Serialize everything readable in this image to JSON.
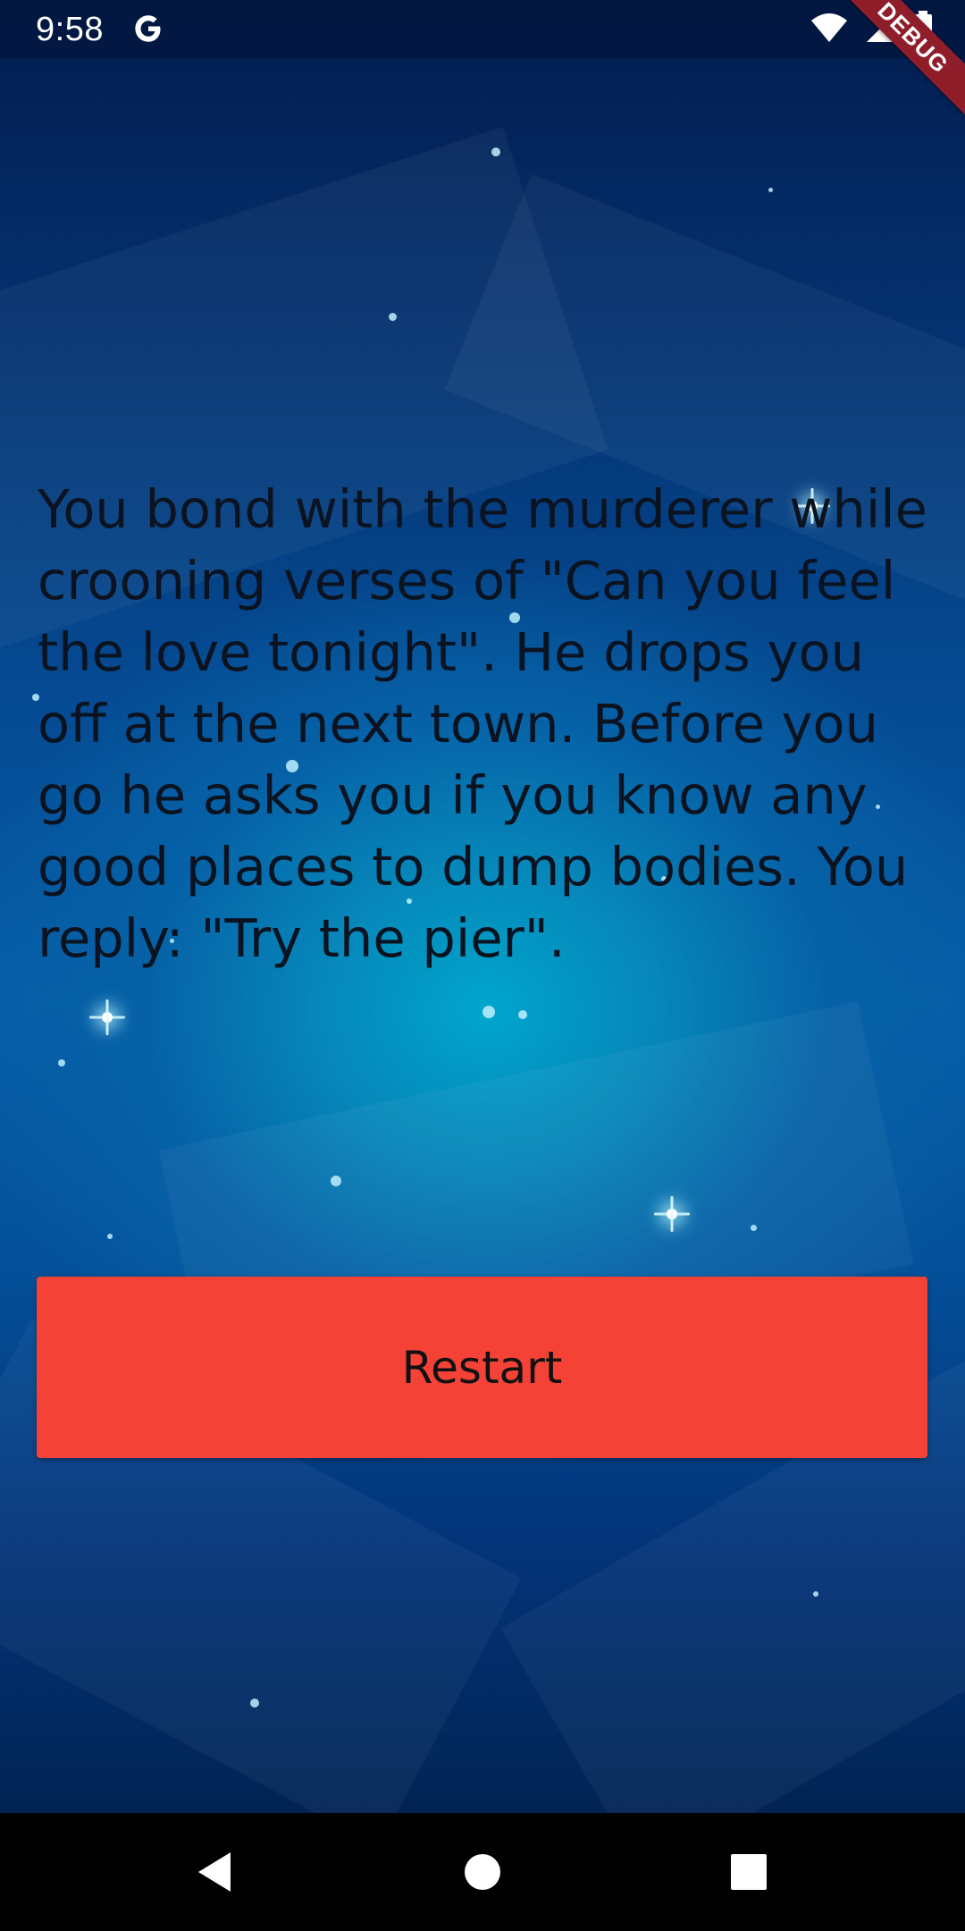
{
  "status_bar": {
    "time": "9:58",
    "notification_icons": [
      "google-g-icon"
    ],
    "system_icons": [
      "wifi-icon",
      "signal-icon",
      "battery-icon"
    ],
    "debug_banner": "DEBUG"
  },
  "story": {
    "text": "You bond with the murderer while crooning verses of \"Can you feel the love tonight\". He drops you off at the next town. Before you go he asks you if you know any good places to dump bodies. You reply: \"Try the pier\"."
  },
  "actions": {
    "restart_label": "Restart"
  },
  "nav_bar": {
    "icons": [
      "back-icon",
      "home-icon",
      "recents-icon"
    ]
  },
  "colors": {
    "button": "#f44336",
    "text": "#0c1320",
    "debug": "#8f1d2a",
    "background_center": "#00a6cc",
    "background_edge": "#031c4e"
  }
}
